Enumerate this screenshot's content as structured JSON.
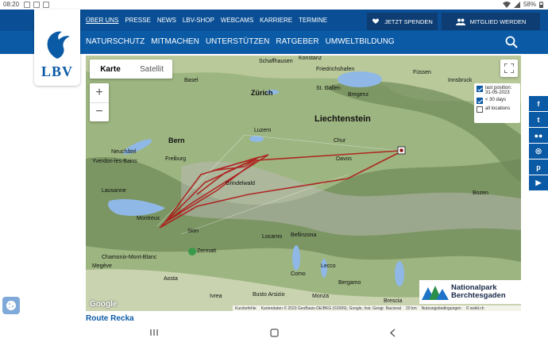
{
  "status": {
    "time": "08:20",
    "battery": "58%"
  },
  "logo": {
    "text": "LBV"
  },
  "top_nav": {
    "links": [
      "ÜBER UNS",
      "PRESSE",
      "NEWS",
      "LBV-SHOP",
      "WEBCAMS",
      "KARRIERE",
      "TERMINE"
    ],
    "donate_label": "JETZT SPENDEN",
    "member_label": "MITGLIED WERDEN"
  },
  "sub_nav": {
    "links": [
      "NATURSCHUTZ",
      "MITMACHEN",
      "UNTERSTÜTZEN",
      "RATGEBER",
      "UMWELTBILDUNG"
    ]
  },
  "map": {
    "toggle": {
      "map_label": "Karte",
      "satellite_label": "Satellit"
    },
    "zoom_in": "+",
    "zoom_out": "−",
    "legend": {
      "last_position": "last position: 31-05-2023",
      "days": "< 30 days",
      "all_locations": "all locations"
    },
    "labels": {
      "liechtenstein": "Liechtenstein",
      "zurich": "Zürich",
      "bern": "Bern",
      "lausanne": "Lausanne",
      "konstanz": "Konstanz",
      "basel": "Basel",
      "luzern": "Luzern",
      "davos": "Davos",
      "zermatt": "Zermatt",
      "bergamo": "Bergamo",
      "brescia": "Brescia",
      "monza": "Monza",
      "innsbruck": "Innsbruck",
      "bozen": "Bozen",
      "freiburg": "Freiburg",
      "st_gallen": "St. Gallen",
      "chur": "Chur",
      "schaffhausen": "Schaffhausen",
      "friedrichshafen": "Friedrichshafen",
      "grindelwald": "Grindelwald",
      "locarno": "Locarno",
      "bellinzona": "Bellinzona",
      "chamonix": "Chamonix-Mont-Blanc",
      "megeve": "Megève",
      "aosta": "Aosta",
      "ivrea": "Ivrea",
      "busto": "Busto Arsizio",
      "como": "Como",
      "lecco": "Lecco",
      "bregenz": "Bregenz",
      "fussen": "Füssen",
      "sion": "Sion",
      "montreux": "Montreux",
      "yverdon": "Yverdon-les-Bains",
      "neuchatel": "Neuchâtel"
    },
    "np_logo": {
      "line1": "Nationalpark",
      "line2": "Berchtesgaden"
    },
    "google": "Google",
    "attribution": {
      "shortcuts": "Kurzbefehle",
      "data": "Kartendaten © 2023 GeoBasis-DE/BKG (©2009), Google, Inst. Geogr. Nacional",
      "scale": "20 km",
      "terms": "Nutzungsbedingungen",
      "credit": "© swild.ch"
    }
  },
  "social": [
    "f",
    "t",
    "●●",
    "◎",
    "p",
    "▶"
  ],
  "route_title": "Route Recka",
  "colors": {
    "primary": "#0b5aa6",
    "dark": "#0a4f95",
    "route": "#b01818"
  }
}
